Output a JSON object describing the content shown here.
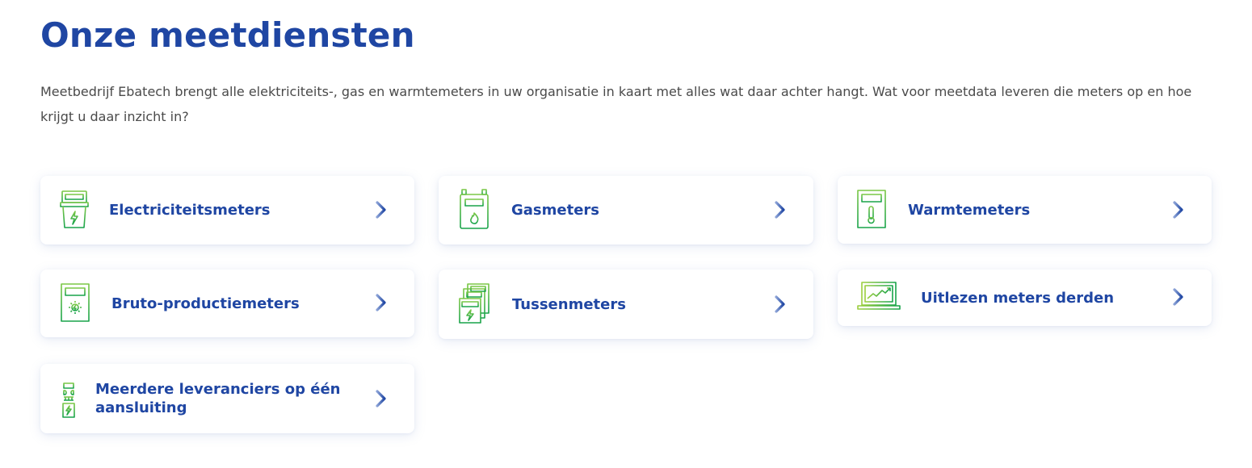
{
  "page": {
    "title": "Onze meetdiensten",
    "intro": "Meetbedrijf Ebatech brengt alle elektriciteits-, gas en warmtemeters in uw organisatie in kaart met alles wat daar achter hangt. Wat voor meetdata leveren die meters op en hoe krijgt u daar inzicht in?"
  },
  "colors": {
    "heading": "#1f46a3",
    "text": "#4a4a4a",
    "icon_gradient_start": "#6cc24a",
    "icon_gradient_end": "#1aa84a"
  },
  "services": [
    {
      "label": "Electriciteitsmeters",
      "icon": "electricity-meter-icon"
    },
    {
      "label": "Gasmeters",
      "icon": "gas-meter-icon"
    },
    {
      "label": "Warmtemeters",
      "icon": "heat-meter-icon"
    },
    {
      "label": "Bruto-productiemeters",
      "icon": "production-meter-icon"
    },
    {
      "label": "Tussenmeters",
      "icon": "sub-meters-icon"
    },
    {
      "label": "Uitlezen meters derden",
      "icon": "laptop-chart-icon"
    },
    {
      "label": "Meerdere leveranciers op één aansluiting",
      "icon": "multi-supplier-icon"
    }
  ]
}
